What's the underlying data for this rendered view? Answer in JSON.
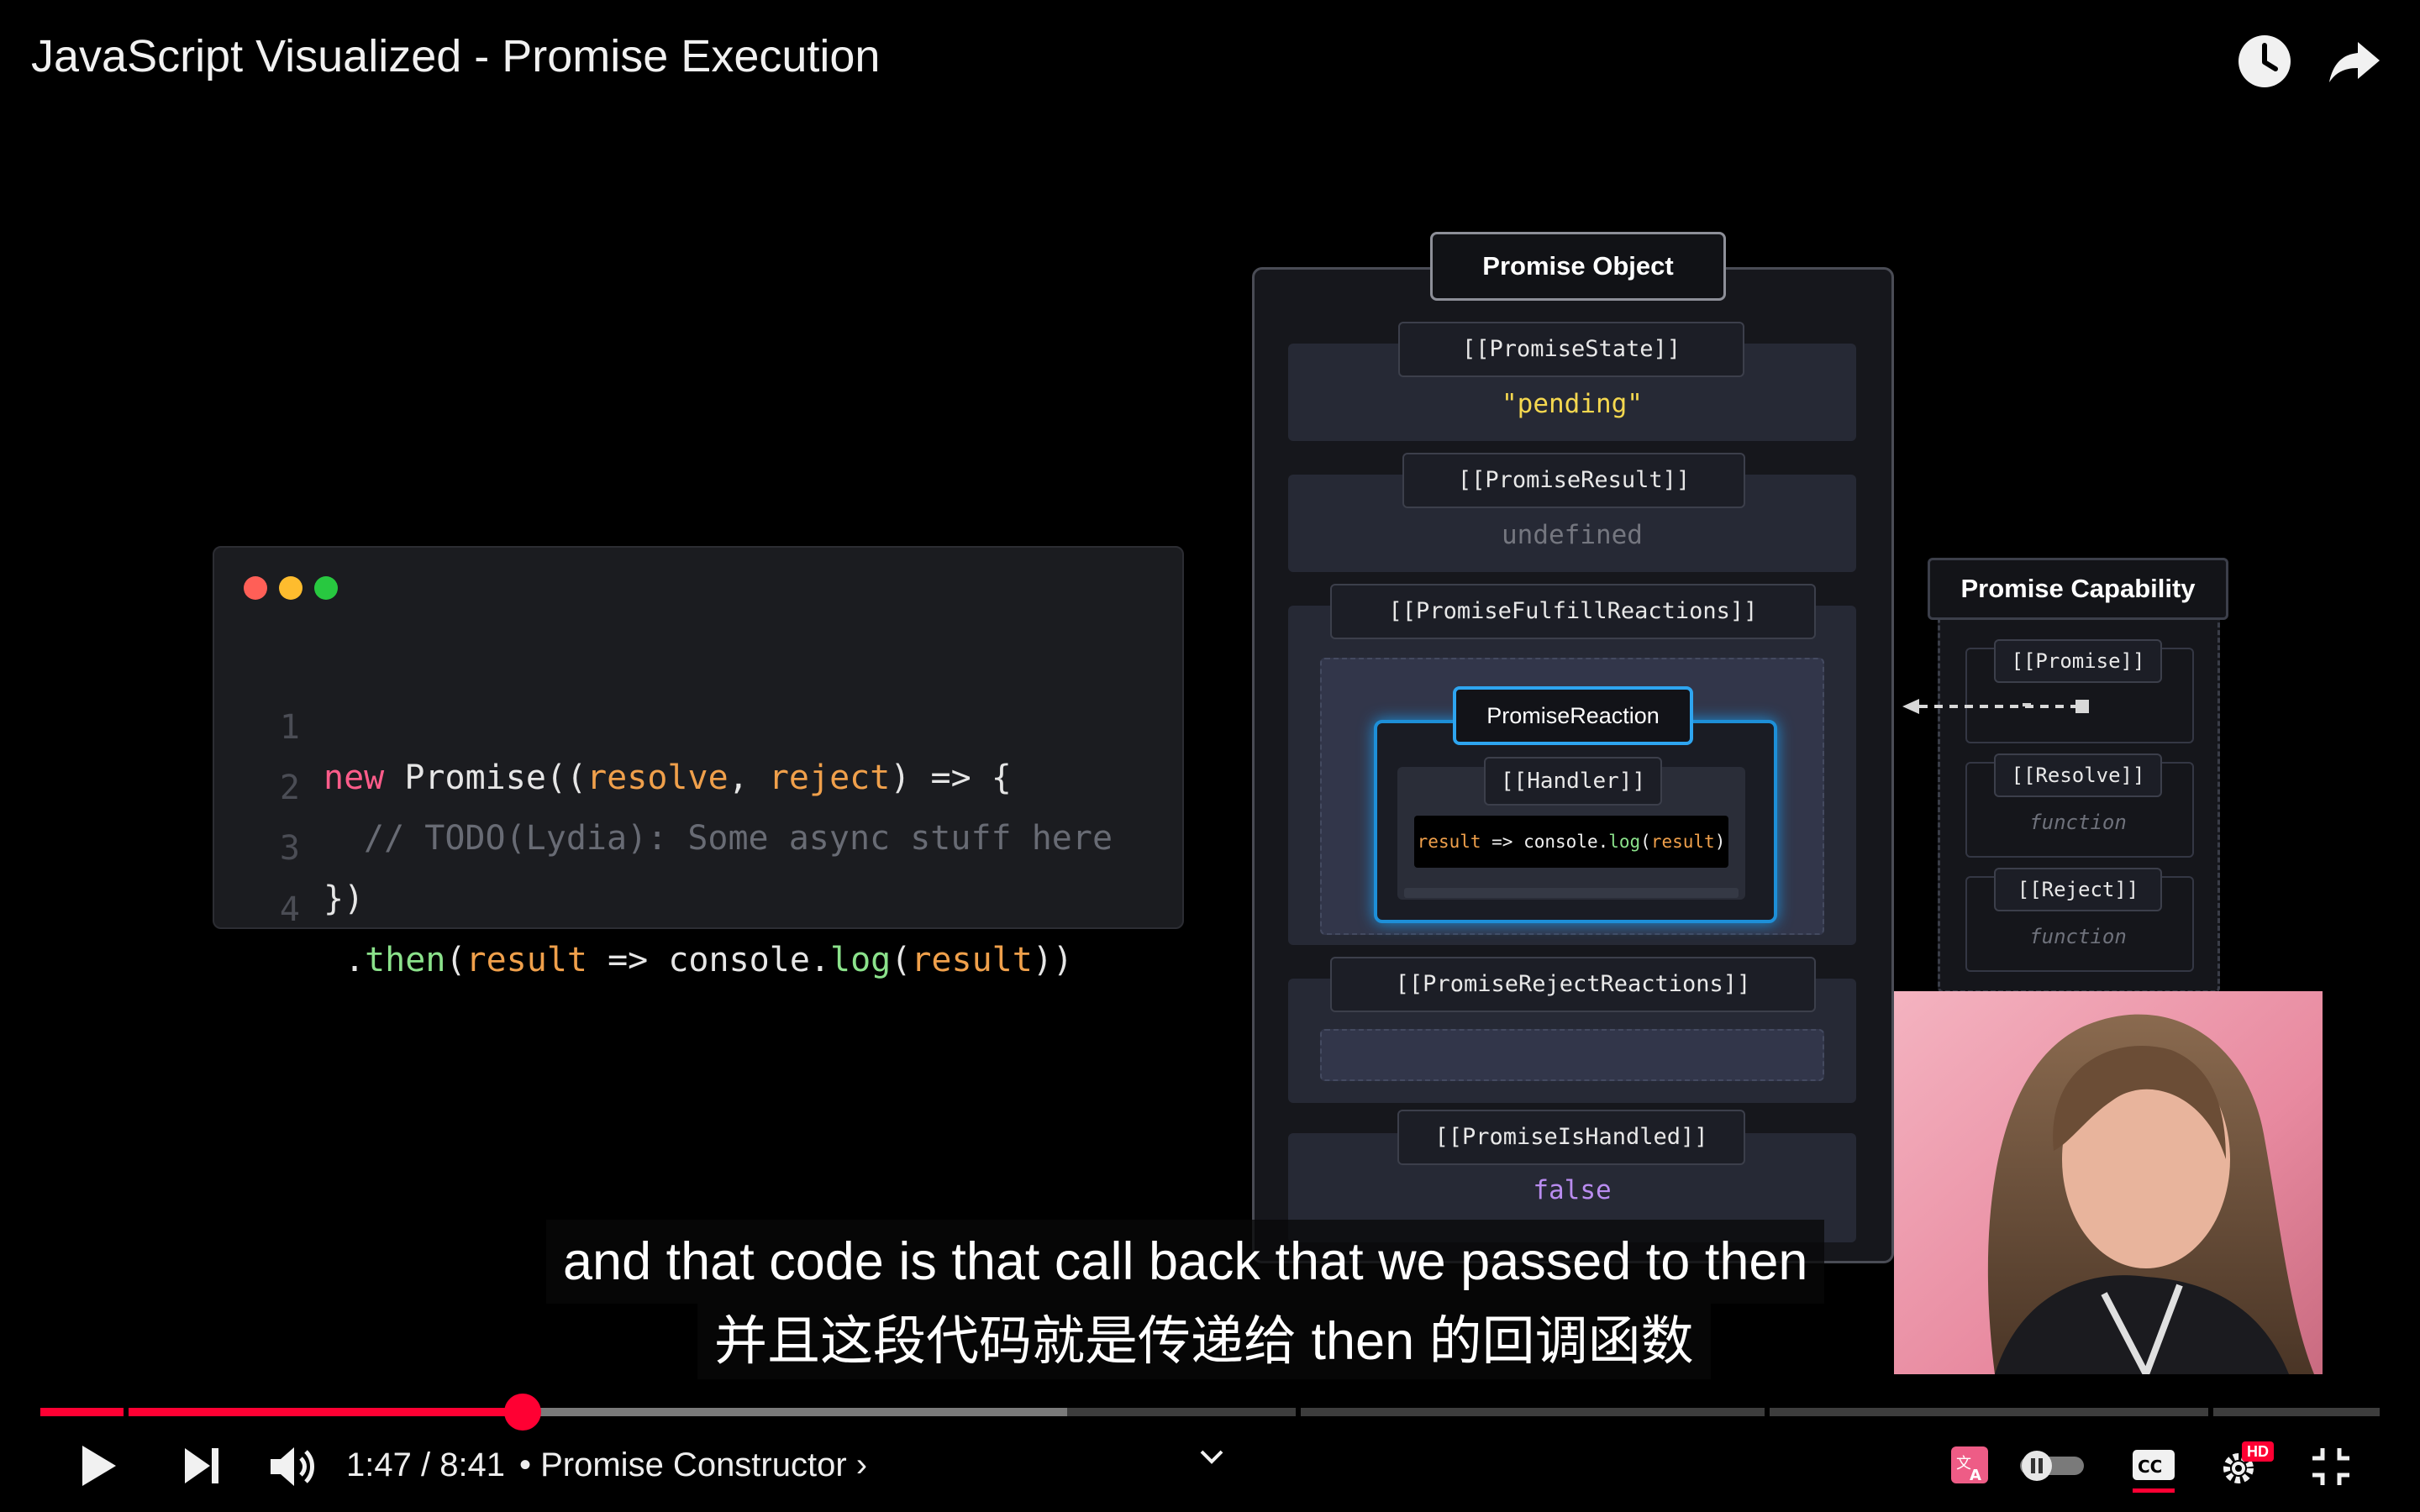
{
  "video": {
    "title": "JavaScript Visualized - Promise Execution"
  },
  "code_window": {
    "lines": [
      {
        "num": "1",
        "kw": "new",
        "text1": " Promise((",
        "p1": "resolve",
        "sep": ", ",
        "p2": "reject",
        "text2": ") => {"
      },
      {
        "num": "2",
        "comment": "// TODO(Lydia): Some async stuff here"
      },
      {
        "num": "3",
        "text": "})"
      },
      {
        "num": "4",
        "dot": ".",
        "fn1": "then",
        "open": "(",
        "p1": "result",
        "arrow": " => console.",
        "fn2": "log",
        "open2": "(",
        "p2": "result",
        "close": "))"
      }
    ]
  },
  "promise_object": {
    "title": "Promise Object",
    "state_label": "[[PromiseState]]",
    "state_value": "\"pending\"",
    "result_label": "[[PromiseResult]]",
    "result_value": "undefined",
    "fulfill_label": "[[PromiseFulfillReactions]]",
    "reaction_title": "PromiseReaction",
    "handler_label": "[[Handler]]",
    "handler_code": {
      "p1": "result",
      "mid": " => console.",
      "fn": "log",
      "open": "(",
      "p2": "result",
      "close": ")"
    },
    "reject_label": "[[PromiseRejectReactions]]",
    "handled_label": "[[PromiseIsHandled]]",
    "handled_value": "false"
  },
  "promise_capability": {
    "title": "Promise Capability",
    "promise_label": "[[Promise]]",
    "resolve_label": "[[Resolve]]",
    "resolve_value": "function",
    "reject_label": "[[Reject]]",
    "reject_value": "function"
  },
  "subtitles": {
    "en": "and that code is that call back that we passed to then",
    "zh": "并且这段代码就是传递给 then 的回调函数"
  },
  "player": {
    "time": "1:47 / 8:41",
    "chapter": "• Promise Constructor",
    "chapter_chevron": "›",
    "progress_played": 0.206,
    "progress_buffered": 0.439,
    "hd_badge": "HD",
    "colors": {
      "accent": "#ff0033",
      "buffered": "#7a7a7a",
      "track": "#3d3d3d"
    }
  }
}
